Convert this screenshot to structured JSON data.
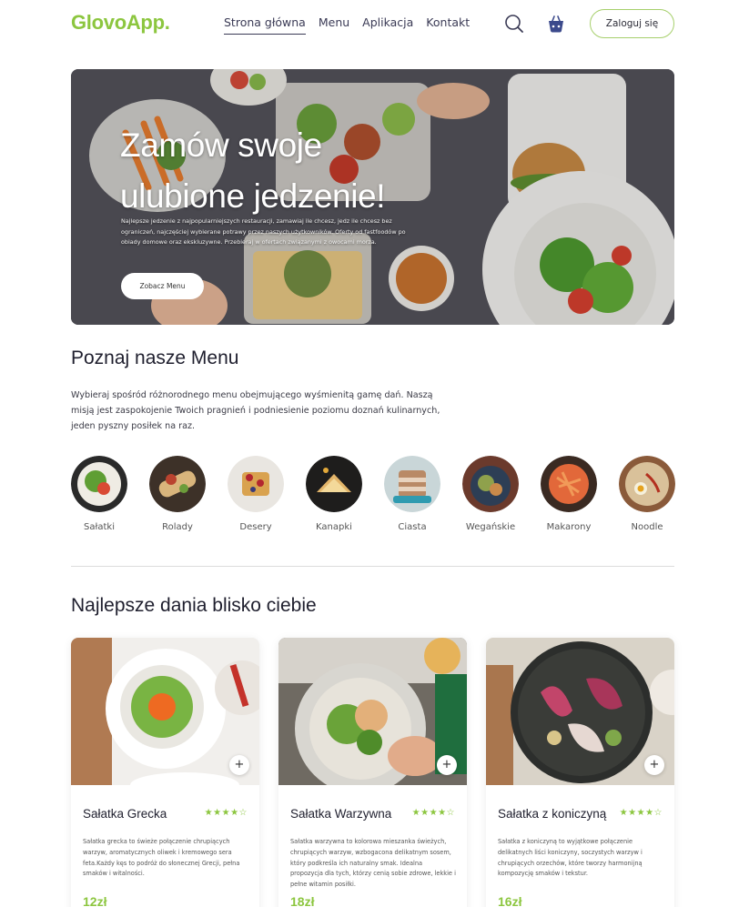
{
  "header": {
    "logo": "GlovoApp.",
    "nav": [
      {
        "label": "Strona główna",
        "active": true
      },
      {
        "label": "Menu",
        "active": false
      },
      {
        "label": "Aplikacja",
        "active": false
      },
      {
        "label": "Kontakt",
        "active": false
      }
    ],
    "icons": [
      "search-icon",
      "basket-icon"
    ],
    "login_label": "Zaloguj się"
  },
  "hero": {
    "title_line1": "Zamów swoje",
    "title_line2": "ulubione jedzenie!",
    "description": "Najlepsze jedzenie z najpopularniejszych restauracji, zamawiaj ile chcesz, jedz ile chcesz bez ograniczeń, najczęściej wybierane potrawy przez naszych użytkowników. Oferty od fastfoodów po obiady domowe oraz ekskluzywne. Przebieraj w ofertach związanymi z owocami morza.",
    "button_label": "Zobacz Menu"
  },
  "menu_section": {
    "title": "Poznaj nasze Menu",
    "description": "Wybieraj spośród różnorodnego menu obejmującego wyśmienitą gamę dań. Naszą misją jest zaspokojenie Twoich pragnień i podniesienie poziomu doznań kulinarnych, jeden pyszny posiłek na raz.",
    "categories": [
      "Sałatki",
      "Rolady",
      "Desery",
      "Kanapki",
      "Ciasta",
      "Wegańskie",
      "Makarony",
      "Noodle"
    ]
  },
  "dishes_section": {
    "title": "Najlepsze dania blisko ciebie",
    "dishes": [
      {
        "name": "Sałatka Grecka",
        "rating": "★★★★☆",
        "description": "Sałatka grecka to świeże połączenie chrupiących warzyw, aromatycznych oliwek i kremowego sera feta.Każdy kęs to podróż do słonecznej Grecji, pełna smaków i witalności.",
        "price": "12zł"
      },
      {
        "name": "Sałatka Warzywna",
        "rating": "★★★★☆",
        "description": "Sałatka warzywna to kolorowa mieszanka świeżych, chrupiących warzyw, wzbogacona delikatnym sosem, który podkreśla ich naturalny smak. Idealna propozycja dla tych, którzy cenią sobie zdrowe, lekkie i pełne witamin posiłki.",
        "price": "18zł"
      },
      {
        "name": "Sałatka z koniczyną",
        "rating": "★★★★☆",
        "description": "Sałatka z koniczyną to wyjątkowe połączenie delikatnych liści koniczyny, soczystych warzyw i chrupiących orzechów, które tworzy harmonijną kompozycję smaków i tekstur.",
        "price": "16zł"
      }
    ],
    "add_label": "+"
  },
  "colors": {
    "accent": "#8cc63f",
    "text": "#2b2b36"
  }
}
